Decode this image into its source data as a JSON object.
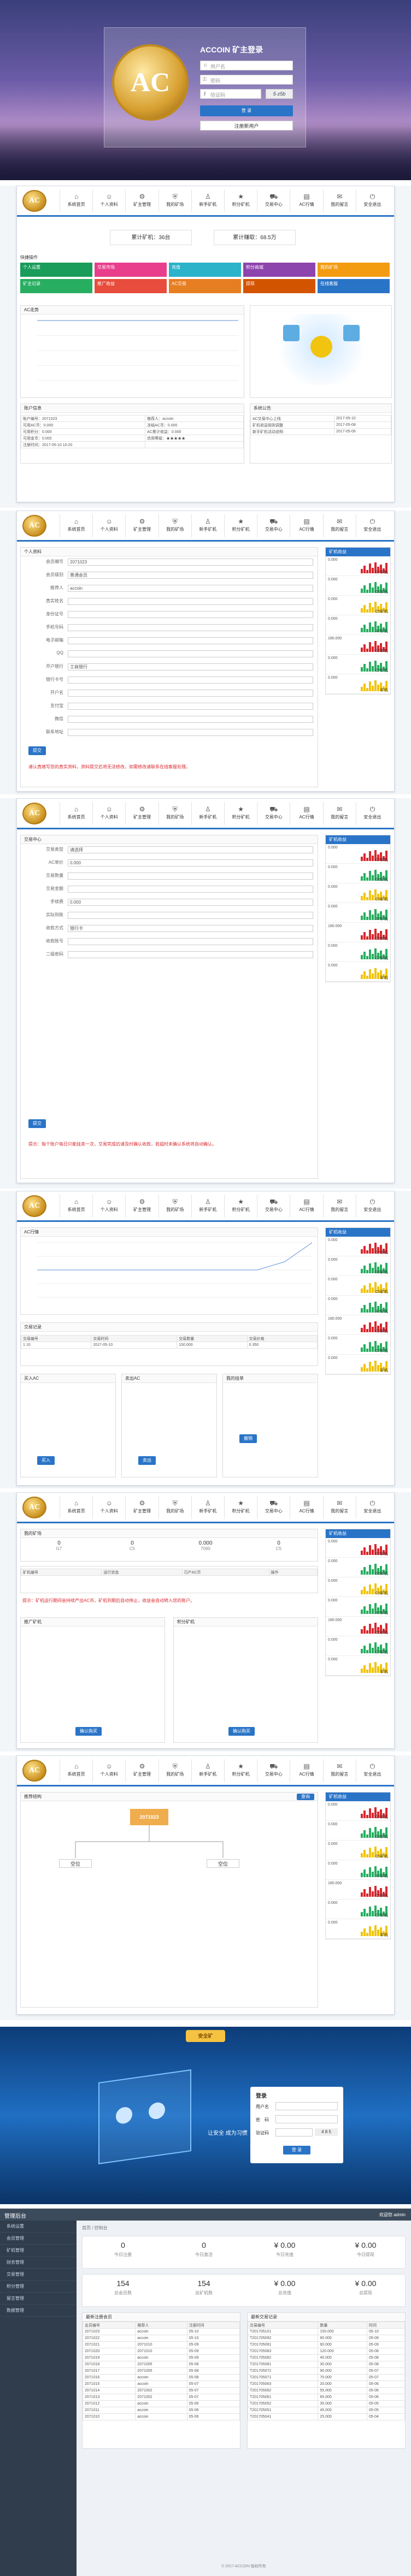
{
  "login": {
    "title": "ACCOIN 矿主登录",
    "logo_text": "AC",
    "fields": [
      {
        "icon": "user-icon",
        "value": "用户名"
      },
      {
        "icon": "lock-icon",
        "value": "密码"
      },
      {
        "icon": "key-icon",
        "value": "验证码"
      }
    ],
    "captcha_text": "5·z5b",
    "submit_label": "登 录",
    "register_label": "注册新用户"
  },
  "nav": {
    "logo_text": "AC",
    "items": [
      {
        "icon": "home-icon",
        "label": "系统首页"
      },
      {
        "icon": "user-icon",
        "label": "个人资料"
      },
      {
        "icon": "gear-icon",
        "label": "矿主管理"
      },
      {
        "icon": "shield-icon",
        "label": "我的矿场"
      },
      {
        "icon": "person-icon",
        "label": "新手矿机"
      },
      {
        "icon": "star-icon",
        "label": "积分矿机"
      },
      {
        "icon": "cart-icon",
        "label": "交易中心"
      },
      {
        "icon": "chart-icon",
        "label": "AC行情"
      },
      {
        "icon": "mail-icon",
        "label": "我的留言"
      },
      {
        "icon": "power-icon",
        "label": "安全退出"
      }
    ]
  },
  "home": {
    "banner_left": "累计矿机：36台",
    "banner_right": "累计赚取：68.5万",
    "quick_label": "快捷操作",
    "tiles": [
      {
        "label": "个人设置",
        "color": "#1a9c5b"
      },
      {
        "label": "交易市场",
        "color": "#e83e8c"
      },
      {
        "label": "充值",
        "color": "#2ab3c9"
      },
      {
        "label": "积分商城",
        "color": "#8e44ad"
      },
      {
        "label": "我的矿场",
        "color": "#f39c12"
      },
      {
        "label": "矿主记录",
        "color": "#27ae60"
      },
      {
        "label": "推广收益",
        "color": "#e74c3c"
      },
      {
        "label": "AC交易",
        "color": "#e67e22"
      },
      {
        "label": "提现",
        "color": "#d35400"
      },
      {
        "label": "在线客服",
        "color": "#2a74c7"
      }
    ],
    "chart_title": "AC走势",
    "chart_legend": "收益",
    "info_title": "账户信息",
    "info_rows": [
      [
        "账户编号：2071023",
        "推荐人：accoin"
      ],
      [
        "可用AC币：0.000",
        "冻结AC币：0.000"
      ],
      [
        "可用积分：0.000",
        "AC累计收益：0.000"
      ],
      [
        "可用金币：0.000",
        "信用等级：★★★★★"
      ],
      [
        "注册时间：2017-05-10 10:20",
        ""
      ]
    ],
    "notice_title": "系统公告",
    "notice_rows": [
      [
        "AC交易中心上线",
        "2017-05-10"
      ],
      [
        "矿机收益规则调整",
        "2017-05-08"
      ],
      [
        "新手矿机活动说明",
        "2017-05-06"
      ]
    ]
  },
  "profile": {
    "panel_title": "个人资料",
    "rows": [
      {
        "label": "会员编号",
        "value": "2071023"
      },
      {
        "label": "会员级别",
        "value": "普通会员"
      },
      {
        "label": "推荐人",
        "value": "accoin"
      },
      {
        "label": "真实姓名",
        "value": ""
      },
      {
        "label": "身份证号",
        "value": ""
      },
      {
        "label": "手机号码",
        "value": ""
      },
      {
        "label": "电子邮箱",
        "value": ""
      },
      {
        "label": "QQ",
        "value": ""
      },
      {
        "label": "开户银行",
        "value": "工商银行"
      },
      {
        "label": "银行卡号",
        "value": ""
      },
      {
        "label": "开户名",
        "value": ""
      },
      {
        "label": "支付宝",
        "value": ""
      },
      {
        "label": "微信",
        "value": ""
      },
      {
        "label": "联系地址",
        "value": ""
      }
    ],
    "submit_label": "提交",
    "notice": "请认真填写您的真实资料，资料提交后将无法修改，如需修改请联系在线客服处理。"
  },
  "side": {
    "title": "矿机收益",
    "items": [
      {
        "label": "0.000",
        "name": "G7矿机",
        "color": "#d9272e"
      },
      {
        "label": "0.000",
        "name": "G6矿机",
        "color": "#27ae60"
      },
      {
        "label": "0.000",
        "name": "C5矿机",
        "color": "#f1c40f"
      },
      {
        "label": "0.000",
        "name": "A7矿机",
        "color": "#27ae60"
      },
      {
        "label": "180.000",
        "name": "C5矿机",
        "color": "#d9272e"
      },
      {
        "label": "0.000",
        "name": "C7矿机",
        "color": "#27ae60"
      },
      {
        "label": "0.000",
        "name": "矿机",
        "color": "#f1c40f"
      }
    ]
  },
  "trade": {
    "panel_title": "交易中心",
    "rows": [
      {
        "label": "交易类型",
        "value": "请选择"
      },
      {
        "label": "AC单价",
        "value": "0.000"
      },
      {
        "label": "交易数量",
        "value": ""
      },
      {
        "label": "交易金额",
        "value": ""
      },
      {
        "label": "手续费",
        "value": "0.000"
      },
      {
        "label": "实际到账",
        "value": ""
      },
      {
        "label": "收款方式",
        "value": "银行卡"
      },
      {
        "label": "收款账号",
        "value": ""
      },
      {
        "label": "二级密码",
        "value": ""
      }
    ],
    "submit_label": "提交",
    "notice": "提示：每个账户每日只能挂卖一次，交易完成后请及时确认收款，若超时未确认系统将自动确认。"
  },
  "market": {
    "chart_title": "AC行情",
    "chart_legend": "价格",
    "table_title": "交易记录",
    "table_head": [
      "交易编号",
      "交易时间",
      "交易数量",
      "交易价格"
    ],
    "table_rows": [
      [
        "1 10",
        "2017-05-10",
        "150.000",
        "0.350"
      ]
    ],
    "buy_title": "买入AC",
    "sell_title": "卖出AC",
    "order_title": "我的挂单",
    "buy_label": "买入",
    "sell_label": "卖出",
    "cancel_label": "撤销"
  },
  "mine": {
    "panel_title": "我的矿场",
    "stats": [
      {
        "name": "G7",
        "value": "0"
      },
      {
        "name": "C5",
        "value": "0"
      },
      {
        "name": "7090",
        "value": "0.000"
      },
      {
        "name": "C5",
        "value": "0"
      }
    ],
    "table_head": [
      "矿机编号",
      "运行状态",
      "已产AC币",
      "操作"
    ],
    "notice": "提示：矿机运行期间会持续产出AC币，矿机到期后自动停止，收益会自动转入您的账户。",
    "left_title": "推广矿机",
    "right_title": "积分矿机",
    "buy_label": "确认购买"
  },
  "tree": {
    "panel_title": "推荐结构",
    "root_label": "2071023",
    "child_left": "空位",
    "child_right": "空位",
    "search_label": "查询"
  },
  "admin_login": {
    "brand": "安全矿",
    "form_title": "登录",
    "fields": [
      {
        "label": "用户名",
        "value": ""
      },
      {
        "label": "密　码",
        "value": ""
      },
      {
        "label": "验证码",
        "value": ""
      }
    ],
    "captcha_text": "4 8 5",
    "submit_label": "登 录",
    "slogan": "让安全 成为习惯"
  },
  "dashboard": {
    "brand": "管理后台",
    "header_right": "欢迎您 admin",
    "menu": [
      "系统设置",
      "会员管理",
      "矿机管理",
      "财务管理",
      "交易管理",
      "积分管理",
      "留言管理",
      "数据管理"
    ],
    "breadcrumb": "首页 / 控制台",
    "stats": [
      {
        "value": "0",
        "label": "今日注册"
      },
      {
        "value": "0",
        "label": "今日激活"
      },
      {
        "value": "¥ 0.00",
        "label": "今日充值"
      },
      {
        "value": "¥ 0.00",
        "label": "今日提现"
      }
    ],
    "totals": [
      {
        "value": "154",
        "label": "总会员数"
      },
      {
        "value": "154",
        "label": "总矿机数"
      },
      {
        "value": "¥ 0.00",
        "label": "总充值"
      },
      {
        "value": "¥ 0.00",
        "label": "总提现"
      }
    ],
    "left_table_title": "最新注册会员",
    "right_table_title": "最新交易记录",
    "left_head": [
      "会员编号",
      "推荐人",
      "注册时间"
    ],
    "right_head": [
      "交易编号",
      "数量",
      "时间"
    ],
    "left_rows": [
      [
        "2071023",
        "accoin",
        "05-10"
      ],
      [
        "2071022",
        "accoin",
        "05-10"
      ],
      [
        "2071021",
        "2071010",
        "05-09"
      ],
      [
        "2071020",
        "2071010",
        "05-09"
      ],
      [
        "2071019",
        "accoin",
        "05-09"
      ],
      [
        "2071018",
        "2071005",
        "05-08"
      ],
      [
        "2071017",
        "2071005",
        "05-08"
      ],
      [
        "2071016",
        "accoin",
        "05-08"
      ],
      [
        "2071015",
        "accoin",
        "05-07"
      ],
      [
        "2071014",
        "2071002",
        "05-07"
      ],
      [
        "2071013",
        "2071002",
        "05-07"
      ],
      [
        "2071012",
        "accoin",
        "05-06"
      ],
      [
        "2071011",
        "accoin",
        "05-06"
      ],
      [
        "2071010",
        "accoin",
        "05-06"
      ]
    ],
    "right_rows": [
      [
        "T201705101",
        "150.000",
        "05-10"
      ],
      [
        "T201705092",
        "80.000",
        "05-09"
      ],
      [
        "T201705091",
        "60.000",
        "05-09"
      ],
      [
        "T201705083",
        "120.000",
        "05-08"
      ],
      [
        "T201705082",
        "40.000",
        "05-08"
      ],
      [
        "T201705081",
        "30.000",
        "05-08"
      ],
      [
        "T201705072",
        "90.000",
        "05-07"
      ],
      [
        "T201705071",
        "75.000",
        "05-07"
      ],
      [
        "T201705063",
        "20.000",
        "05-06"
      ],
      [
        "T201705062",
        "55.000",
        "05-06"
      ],
      [
        "T201705061",
        "65.000",
        "05-06"
      ],
      [
        "T201705052",
        "35.000",
        "05-05"
      ],
      [
        "T201705051",
        "45.000",
        "05-05"
      ],
      [
        "T201705041",
        "25.000",
        "05-04"
      ]
    ],
    "footer": "© 2017 ACCOIN 版权所有"
  }
}
